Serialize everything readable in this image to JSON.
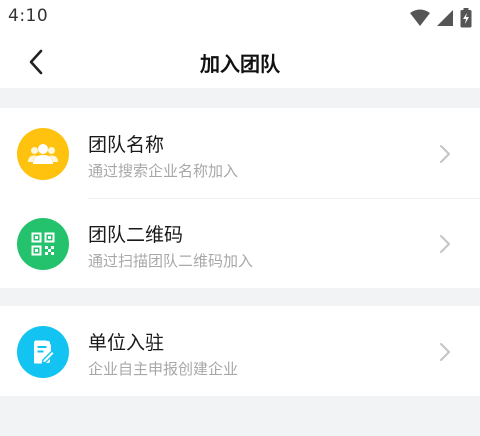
{
  "status_bar": {
    "time": "4:10",
    "icons": [
      "wifi-icon",
      "signal-icon",
      "battery-charging-icon"
    ]
  },
  "nav": {
    "back_icon": "chevron-left-icon",
    "title": "加入团队"
  },
  "options": [
    {
      "title": "团队名称",
      "subtitle": "通过搜索企业名称加入",
      "icon": "people-icon",
      "color": "#FFC20E"
    },
    {
      "title": "团队二维码",
      "subtitle": "通过扫描团队二维码加入",
      "icon": "qr-code-icon",
      "color": "#25C26E"
    },
    {
      "title": "单位入驻",
      "subtitle": "企业自主申报创建企业",
      "icon": "edit-document-icon",
      "color": "#13C4F2"
    }
  ],
  "colors": {
    "background": "#F2F3F5",
    "card": "#FFFFFF",
    "subtitle": "#A8A8A8",
    "chevron": "#C4C4C4"
  }
}
